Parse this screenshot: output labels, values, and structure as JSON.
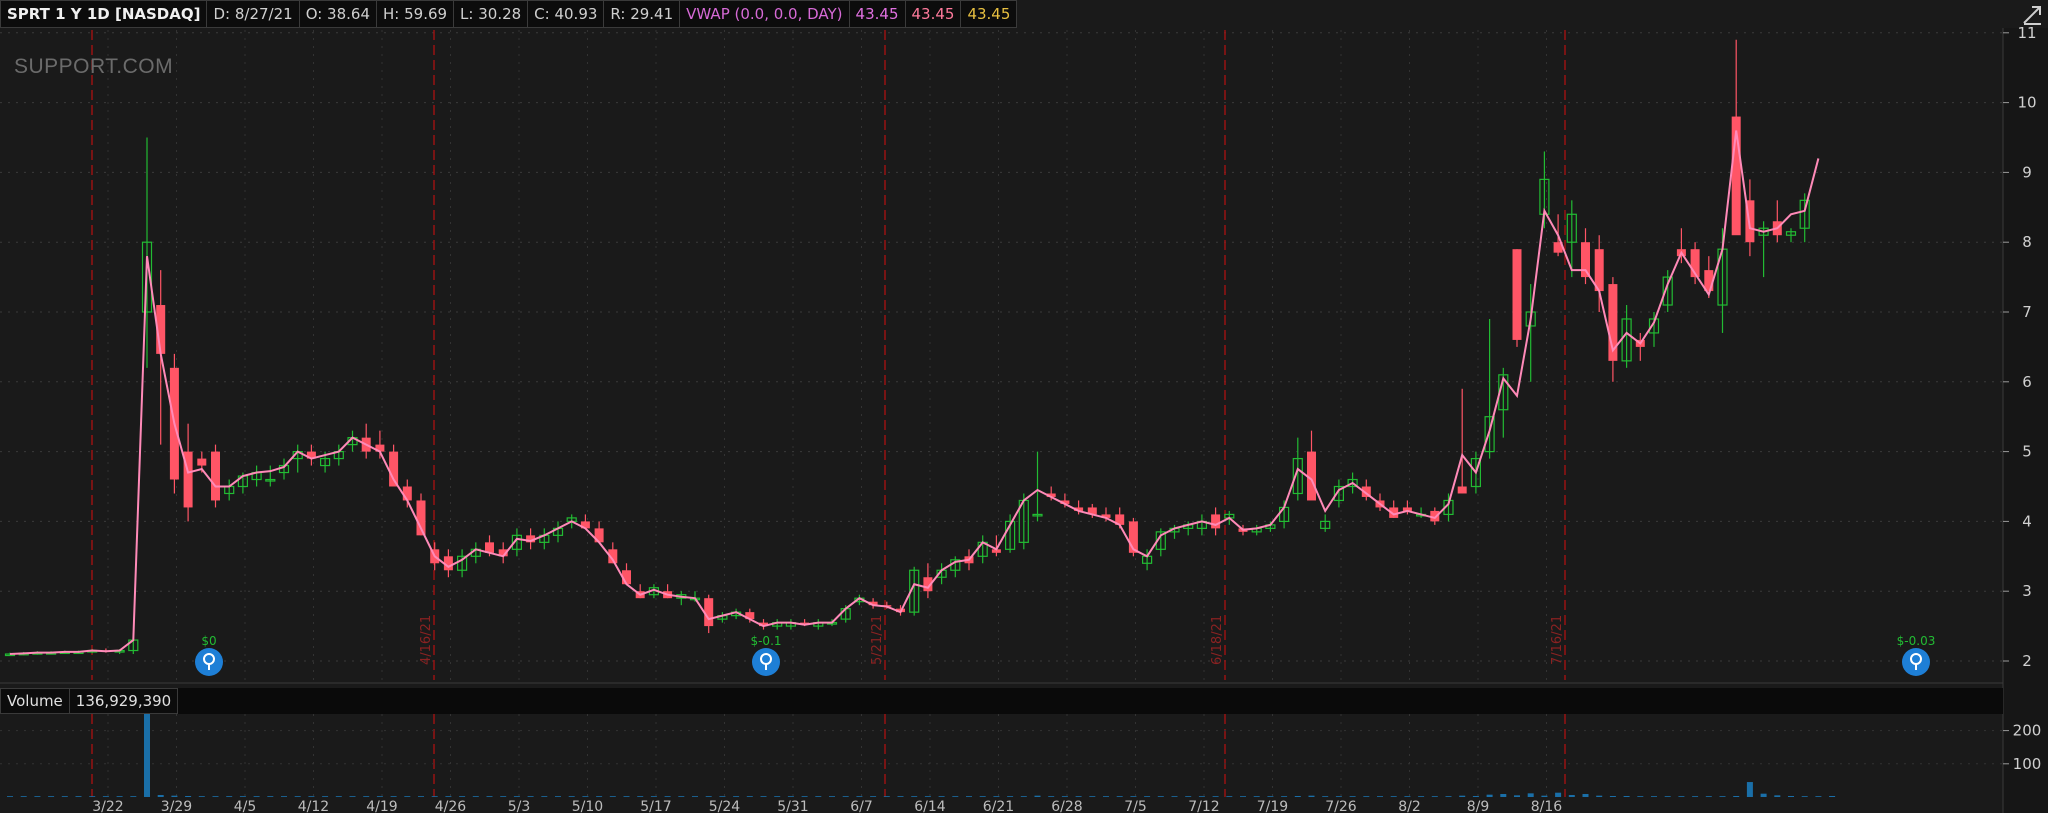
{
  "header": {
    "symbol": "SPRT 1 Y 1D [NASDAQ]",
    "date": "D: 8/27/21",
    "open": "O: 38.64",
    "high": "H: 59.69",
    "low": "L: 30.28",
    "close": "C: 40.93",
    "range": "R: 29.41",
    "vwap_label": "VWAP (0.0, 0.0, DAY)",
    "vwap_values": [
      "43.45",
      "43.45",
      "43.45"
    ]
  },
  "watermark": "SUPPORT.COM",
  "volume_header": {
    "label": "Volume",
    "value": "136,929,390"
  },
  "events": [
    {
      "date_label": "4/16/21"
    },
    {
      "date_label": "5/21/21"
    },
    {
      "date_label": "6/18/21"
    },
    {
      "date_label": "7/16/21"
    }
  ],
  "earnings": [
    {
      "label": "$0"
    },
    {
      "label": "$-0.1"
    },
    {
      "label": "$-0.03"
    }
  ],
  "chart_data": {
    "type": "candlestick",
    "x_tick_labels": [
      "3/22",
      "3/29",
      "4/5",
      "4/12",
      "4/19",
      "4/26",
      "5/3",
      "5/10",
      "5/17",
      "5/24",
      "5/31",
      "6/7",
      "6/14",
      "6/21",
      "6/28",
      "7/5",
      "7/12",
      "7/19",
      "7/26",
      "8/2",
      "8/9",
      "8/16"
    ],
    "y_ticks": [
      2,
      3,
      4,
      5,
      6,
      7,
      8,
      9,
      10,
      11
    ],
    "ylim": [
      1.8,
      11.5
    ],
    "volume_ticks": [
      100,
      200
    ],
    "volume_ylim": [
      0,
      250
    ],
    "colors": {
      "up": "#22bb33",
      "down": "#ff5566",
      "vwap": "#ff8ab8",
      "volume": "#1a6fa8",
      "event_line": "#aa1111",
      "earnings": "#1e7fd6"
    },
    "candles": [
      [
        2.1,
        2.12,
        2.08,
        2.1
      ],
      [
        2.1,
        2.13,
        2.08,
        2.11
      ],
      [
        2.11,
        2.14,
        2.09,
        2.12
      ],
      [
        2.12,
        2.14,
        2.1,
        2.12
      ],
      [
        2.12,
        2.15,
        2.1,
        2.13
      ],
      [
        2.13,
        2.15,
        2.1,
        2.13
      ],
      [
        2.13,
        2.17,
        2.11,
        2.15
      ],
      [
        2.15,
        2.18,
        2.12,
        2.14
      ],
      [
        2.14,
        2.17,
        2.1,
        2.15
      ],
      [
        2.15,
        2.4,
        2.1,
        2.3
      ],
      [
        7.0,
        9.5,
        6.2,
        8.0
      ],
      [
        7.1,
        7.6,
        5.1,
        6.4
      ],
      [
        6.2,
        6.4,
        4.4,
        4.6
      ],
      [
        5.0,
        5.4,
        4.0,
        4.2
      ],
      [
        4.9,
        5.0,
        4.7,
        4.8
      ],
      [
        5.0,
        5.1,
        4.2,
        4.3
      ],
      [
        4.4,
        4.6,
        4.3,
        4.5
      ],
      [
        4.5,
        4.7,
        4.4,
        4.65
      ],
      [
        4.6,
        4.8,
        4.5,
        4.7
      ],
      [
        4.6,
        4.8,
        4.5,
        4.6
      ],
      [
        4.7,
        4.9,
        4.6,
        4.8
      ],
      [
        4.9,
        5.1,
        4.7,
        5.0
      ],
      [
        5.0,
        5.1,
        4.8,
        4.9
      ],
      [
        4.8,
        5.0,
        4.7,
        4.9
      ],
      [
        4.9,
        5.1,
        4.8,
        5.0
      ],
      [
        5.1,
        5.3,
        5.0,
        5.2
      ],
      [
        5.2,
        5.4,
        4.9,
        5.0
      ],
      [
        5.1,
        5.3,
        4.9,
        5.0
      ],
      [
        5.0,
        5.1,
        4.5,
        4.5
      ],
      [
        4.5,
        4.6,
        4.2,
        4.3
      ],
      [
        4.3,
        4.4,
        3.8,
        3.8
      ],
      [
        3.6,
        3.7,
        3.3,
        3.4
      ],
      [
        3.5,
        3.6,
        3.2,
        3.3
      ],
      [
        3.3,
        3.6,
        3.2,
        3.5
      ],
      [
        3.5,
        3.7,
        3.4,
        3.6
      ],
      [
        3.7,
        3.8,
        3.5,
        3.55
      ],
      [
        3.6,
        3.7,
        3.4,
        3.5
      ],
      [
        3.6,
        3.9,
        3.5,
        3.8
      ],
      [
        3.8,
        3.9,
        3.6,
        3.7
      ],
      [
        3.7,
        3.9,
        3.6,
        3.8
      ],
      [
        3.8,
        4.0,
        3.7,
        3.9
      ],
      [
        4.0,
        4.1,
        3.9,
        4.05
      ],
      [
        4.0,
        4.1,
        3.9,
        3.9
      ],
      [
        3.9,
        4.0,
        3.7,
        3.7
      ],
      [
        3.6,
        3.7,
        3.4,
        3.4
      ],
      [
        3.3,
        3.4,
        3.1,
        3.1
      ],
      [
        3.0,
        3.1,
        2.9,
        2.9
      ],
      [
        2.95,
        3.1,
        2.9,
        3.05
      ],
      [
        3.0,
        3.1,
        2.9,
        2.9
      ],
      [
        2.9,
        3.0,
        2.8,
        2.95
      ],
      [
        2.9,
        3.0,
        2.85,
        2.9
      ],
      [
        2.9,
        2.95,
        2.4,
        2.5
      ],
      [
        2.6,
        2.7,
        2.55,
        2.65
      ],
      [
        2.65,
        2.75,
        2.6,
        2.7
      ],
      [
        2.7,
        2.75,
        2.55,
        2.6
      ],
      [
        2.55,
        2.6,
        2.45,
        2.5
      ],
      [
        2.5,
        2.6,
        2.45,
        2.55
      ],
      [
        2.5,
        2.6,
        2.45,
        2.55
      ],
      [
        2.55,
        2.6,
        2.5,
        2.52
      ],
      [
        2.5,
        2.6,
        2.45,
        2.55
      ],
      [
        2.55,
        2.6,
        2.5,
        2.55
      ],
      [
        2.6,
        2.8,
        2.55,
        2.75
      ],
      [
        2.85,
        2.95,
        2.8,
        2.9
      ],
      [
        2.85,
        2.9,
        2.75,
        2.8
      ],
      [
        2.8,
        2.85,
        2.75,
        2.78
      ],
      [
        2.75,
        2.8,
        2.65,
        2.7
      ],
      [
        2.7,
        3.35,
        2.65,
        3.3
      ],
      [
        3.2,
        3.4,
        2.9,
        3.0
      ],
      [
        3.2,
        3.4,
        3.1,
        3.3
      ],
      [
        3.3,
        3.5,
        3.2,
        3.45
      ],
      [
        3.5,
        3.6,
        3.3,
        3.4
      ],
      [
        3.5,
        3.8,
        3.4,
        3.7
      ],
      [
        3.6,
        3.8,
        3.5,
        3.55
      ],
      [
        3.6,
        4.1,
        3.55,
        4.0
      ],
      [
        3.7,
        4.4,
        3.6,
        4.3
      ],
      [
        4.1,
        5.0,
        4.0,
        4.1
      ],
      [
        4.4,
        4.5,
        4.3,
        4.35
      ],
      [
        4.3,
        4.4,
        4.2,
        4.25
      ],
      [
        4.2,
        4.3,
        4.1,
        4.15
      ],
      [
        4.2,
        4.25,
        4.05,
        4.1
      ],
      [
        4.1,
        4.2,
        4.0,
        4.05
      ],
      [
        4.1,
        4.2,
        3.9,
        3.95
      ],
      [
        4.0,
        4.05,
        3.5,
        3.55
      ],
      [
        3.4,
        3.6,
        3.3,
        3.5
      ],
      [
        3.6,
        3.9,
        3.5,
        3.85
      ],
      [
        3.85,
        3.95,
        3.75,
        3.9
      ],
      [
        3.9,
        4.0,
        3.8,
        3.95
      ],
      [
        3.9,
        4.1,
        3.8,
        4.0
      ],
      [
        4.1,
        4.2,
        3.8,
        3.9
      ],
      [
        4.05,
        4.15,
        3.95,
        4.1
      ],
      [
        3.9,
        3.95,
        3.8,
        3.85
      ],
      [
        3.85,
        3.95,
        3.8,
        3.9
      ],
      [
        3.9,
        4.0,
        3.85,
        3.95
      ],
      [
        4.0,
        4.3,
        3.9,
        4.2
      ],
      [
        4.4,
        5.2,
        4.3,
        4.9
      ],
      [
        5.0,
        5.3,
        4.4,
        4.3
      ],
      [
        3.9,
        4.1,
        3.85,
        4.0
      ],
      [
        4.3,
        4.6,
        4.2,
        4.5
      ],
      [
        4.5,
        4.7,
        4.4,
        4.6
      ],
      [
        4.5,
        4.6,
        4.3,
        4.35
      ],
      [
        4.3,
        4.4,
        4.15,
        4.2
      ],
      [
        4.2,
        4.3,
        4.05,
        4.05
      ],
      [
        4.2,
        4.3,
        4.1,
        4.15
      ],
      [
        4.1,
        4.2,
        4.05,
        4.1
      ],
      [
        4.15,
        4.2,
        3.95,
        4.0
      ],
      [
        4.1,
        4.4,
        4.0,
        4.3
      ],
      [
        4.5,
        5.9,
        4.4,
        4.4
      ],
      [
        4.5,
        5.0,
        4.4,
        4.9
      ],
      [
        5.0,
        6.9,
        4.9,
        5.5
      ],
      [
        5.6,
        6.2,
        5.2,
        6.1
      ],
      [
        7.9,
        7.9,
        6.5,
        6.6
      ],
      [
        6.8,
        7.4,
        6.0,
        7.0
      ],
      [
        8.4,
        9.3,
        8.2,
        8.9
      ],
      [
        8.0,
        8.4,
        7.8,
        7.85
      ],
      [
        8.0,
        8.6,
        7.5,
        8.4
      ],
      [
        8.0,
        8.2,
        7.4,
        7.5
      ],
      [
        7.9,
        8.1,
        7.0,
        7.3
      ],
      [
        7.4,
        7.5,
        6.0,
        6.3
      ],
      [
        6.3,
        7.1,
        6.2,
        6.9
      ],
      [
        6.6,
        6.7,
        6.3,
        6.5
      ],
      [
        6.7,
        7.0,
        6.5,
        6.9
      ],
      [
        7.1,
        7.6,
        7.0,
        7.5
      ],
      [
        7.9,
        8.2,
        7.7,
        7.8
      ],
      [
        7.9,
        8.0,
        7.4,
        7.5
      ],
      [
        7.6,
        7.8,
        7.2,
        7.3
      ],
      [
        7.1,
        8.2,
        6.7,
        7.9
      ],
      [
        9.8,
        10.9,
        8.2,
        8.1
      ],
      [
        8.6,
        8.9,
        7.8,
        8.0
      ],
      [
        8.1,
        8.3,
        7.5,
        8.2
      ],
      [
        8.3,
        8.6,
        8.0,
        8.1
      ],
      [
        8.1,
        8.2,
        8.0,
        8.15
      ],
      [
        8.2,
        8.7,
        8.0,
        8.6
      ]
    ],
    "vwap": [
      2.1,
      2.11,
      2.12,
      2.12,
      2.13,
      2.13,
      2.15,
      2.14,
      2.15,
      2.3,
      7.8,
      6.4,
      5.4,
      4.7,
      4.75,
      4.5,
      4.5,
      4.65,
      4.7,
      4.72,
      4.78,
      5.0,
      4.9,
      4.95,
      5.0,
      5.2,
      5.1,
      5.0,
      4.6,
      4.3,
      3.9,
      3.5,
      3.35,
      3.45,
      3.6,
      3.55,
      3.5,
      3.75,
      3.72,
      3.8,
      3.9,
      4.0,
      3.9,
      3.7,
      3.45,
      3.1,
      2.95,
      3.02,
      2.95,
      2.92,
      2.9,
      2.6,
      2.65,
      2.7,
      2.6,
      2.5,
      2.55,
      2.55,
      2.52,
      2.55,
      2.55,
      2.75,
      2.9,
      2.8,
      2.78,
      2.7,
      3.1,
      3.05,
      3.3,
      3.42,
      3.45,
      3.7,
      3.6,
      3.95,
      4.3,
      4.45,
      4.35,
      4.25,
      4.15,
      4.1,
      4.05,
      3.95,
      3.6,
      3.5,
      3.8,
      3.9,
      3.95,
      4.0,
      3.95,
      4.05,
      3.88,
      3.9,
      3.95,
      4.2,
      4.75,
      4.6,
      4.15,
      4.45,
      4.55,
      4.4,
      4.25,
      4.1,
      4.15,
      4.1,
      4.05,
      4.25,
      4.95,
      4.7,
      5.3,
      6.05,
      5.8,
      6.9,
      8.45,
      8.1,
      7.6,
      7.6,
      7.3,
      6.45,
      6.7,
      6.55,
      6.85,
      7.4,
      7.85,
      7.55,
      7.25,
      7.9,
      9.6,
      8.2,
      8.15,
      8.2,
      8.4,
      8.45,
      9.2
    ],
    "volume": [
      1,
      1,
      1,
      1,
      1,
      1,
      1,
      1,
      1,
      2,
      285,
      6,
      4,
      3,
      2,
      2,
      2,
      1,
      1,
      1,
      1,
      1,
      1,
      1,
      1,
      1,
      1,
      1,
      2,
      2,
      2,
      2,
      1,
      1,
      1,
      1,
      1,
      1,
      1,
      1,
      1,
      1,
      1,
      1,
      1,
      2,
      2,
      1,
      1,
      1,
      1,
      2,
      1,
      1,
      1,
      1,
      1,
      1,
      1,
      1,
      1,
      1,
      1,
      1,
      1,
      1,
      2,
      2,
      1,
      1,
      1,
      1,
      1,
      1,
      2,
      4,
      2,
      1,
      1,
      1,
      1,
      1,
      2,
      1,
      1,
      1,
      1,
      1,
      1,
      1,
      1,
      1,
      1,
      1,
      3,
      4,
      2,
      1,
      1,
      1,
      1,
      1,
      1,
      1,
      1,
      1,
      4,
      3,
      7,
      9,
      5,
      11,
      4,
      13,
      6,
      9,
      4,
      3,
      3,
      2,
      2,
      2,
      2,
      2,
      2,
      2,
      3,
      45,
      10,
      5,
      3,
      2,
      2,
      3
    ]
  }
}
